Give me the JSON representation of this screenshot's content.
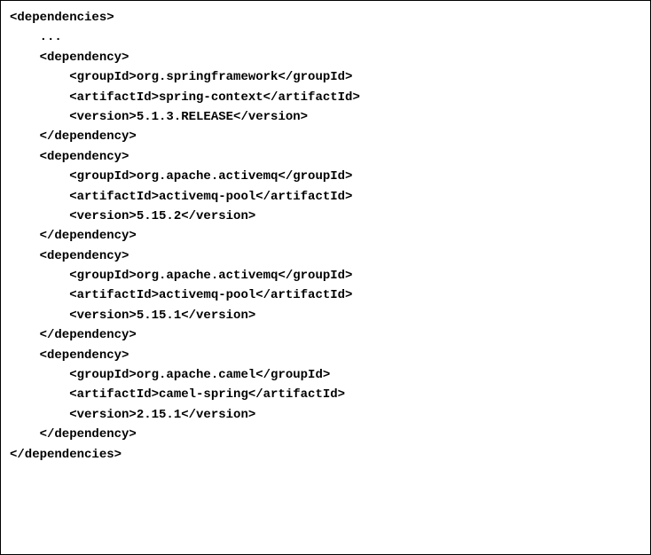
{
  "lines": [
    {
      "indent": 0,
      "text": "<dependencies>"
    },
    {
      "indent": 1,
      "text": "..."
    },
    {
      "indent": 1,
      "text": "<dependency>"
    },
    {
      "indent": 2,
      "text": "<groupId>org.springframework</groupId>"
    },
    {
      "indent": 2,
      "text": "<artifactId>spring-context</artifactId>"
    },
    {
      "indent": 2,
      "text": "<version>5.1.3.RELEASE</version>"
    },
    {
      "indent": 1,
      "text": "</dependency>"
    },
    {
      "indent": 0,
      "text": ""
    },
    {
      "indent": 1,
      "text": "<dependency>"
    },
    {
      "indent": 2,
      "text": "<groupId>org.apache.activemq</groupId>"
    },
    {
      "indent": 2,
      "text": "<artifactId>activemq-pool</artifactId>"
    },
    {
      "indent": 2,
      "text": "<version>5.15.2</version>"
    },
    {
      "indent": 1,
      "text": "</dependency>"
    },
    {
      "indent": 0,
      "text": ""
    },
    {
      "indent": 1,
      "text": "<dependency>"
    },
    {
      "indent": 2,
      "text": "<groupId>org.apache.activemq</groupId>"
    },
    {
      "indent": 2,
      "text": "<artifactId>activemq-pool</artifactId>"
    },
    {
      "indent": 2,
      "text": "<version>5.15.1</version>"
    },
    {
      "indent": 1,
      "text": "</dependency>"
    },
    {
      "indent": 0,
      "text": ""
    },
    {
      "indent": 1,
      "text": "<dependency>"
    },
    {
      "indent": 2,
      "text": "<groupId>org.apache.camel</groupId>"
    },
    {
      "indent": 2,
      "text": "<artifactId>camel-spring</artifactId>"
    },
    {
      "indent": 2,
      "text": "<version>2.15.1</version>"
    },
    {
      "indent": 1,
      "text": "</dependency>"
    },
    {
      "indent": 0,
      "text": "</dependencies>"
    }
  ],
  "indentUnit": "    "
}
